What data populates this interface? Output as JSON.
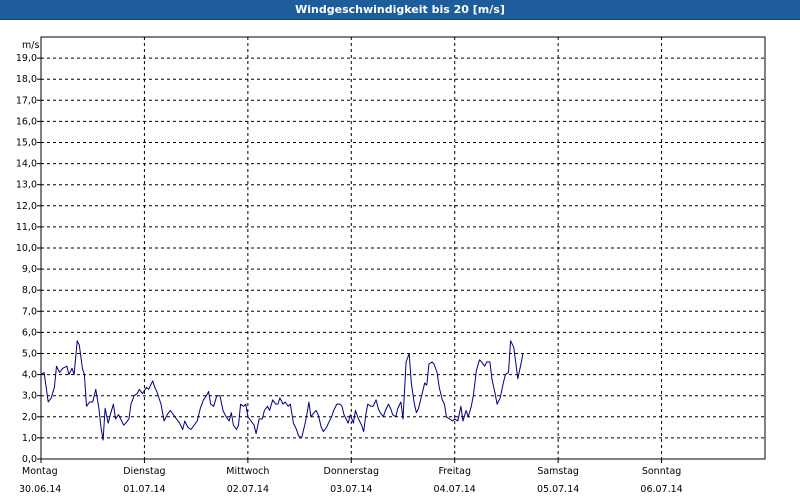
{
  "window": {
    "title": "Windgeschwindigkeit bis 20 [m/s]"
  },
  "colors": {
    "titlebar": "#1d5d9b",
    "line": "#00007f",
    "grid": "#000000"
  },
  "chart_data": {
    "type": "line",
    "title": "Windgeschwindigkeit bis 20 [m/s]",
    "ylabel": "m/s",
    "ylim": [
      0,
      20
    ],
    "yticks": [
      "0,0",
      "1,0",
      "2,0",
      "3,0",
      "4,0",
      "5,0",
      "6,0",
      "7,0",
      "8,0",
      "9,0",
      "10,0",
      "11,0",
      "12,0",
      "13,0",
      "14,0",
      "15,0",
      "16,0",
      "17,0",
      "18,0",
      "19,0"
    ],
    "xlim": [
      0,
      7
    ],
    "grid": "dashed",
    "x_ticks": [
      {
        "day": "Montag",
        "date": "30.06.14",
        "x": 0
      },
      {
        "day": "Dienstag",
        "date": "01.07.14",
        "x": 1
      },
      {
        "day": "Mittwoch",
        "date": "02.07.14",
        "x": 2
      },
      {
        "day": "Donnerstag",
        "date": "03.07.14",
        "x": 3
      },
      {
        "day": "Freitag",
        "date": "04.07.14",
        "x": 4
      },
      {
        "day": "Samstag",
        "date": "05.07.14",
        "x": 5
      },
      {
        "day": "Sonntag",
        "date": "06.07.14",
        "x": 6
      }
    ],
    "series": [
      {
        "points": [
          [
            0.0,
            4.0
          ],
          [
            0.03,
            4.1
          ],
          [
            0.07,
            2.7
          ],
          [
            0.1,
            2.9
          ],
          [
            0.13,
            3.4
          ],
          [
            0.15,
            4.4
          ],
          [
            0.18,
            4.1
          ],
          [
            0.21,
            4.3
          ],
          [
            0.25,
            4.4
          ],
          [
            0.27,
            4.0
          ],
          [
            0.3,
            4.3
          ],
          [
            0.32,
            4.0
          ],
          [
            0.35,
            5.6
          ],
          [
            0.37,
            5.4
          ],
          [
            0.4,
            4.3
          ],
          [
            0.42,
            4.0
          ],
          [
            0.44,
            2.5
          ],
          [
            0.47,
            2.7
          ],
          [
            0.5,
            2.7
          ],
          [
            0.53,
            3.3
          ],
          [
            0.56,
            2.4
          ],
          [
            0.58,
            1.5
          ],
          [
            0.6,
            0.9
          ],
          [
            0.62,
            2.4
          ],
          [
            0.65,
            1.7
          ],
          [
            0.67,
            2.1
          ],
          [
            0.7,
            2.6
          ],
          [
            0.72,
            1.9
          ],
          [
            0.75,
            2.1
          ],
          [
            0.77,
            1.9
          ],
          [
            0.8,
            1.6
          ],
          [
            0.82,
            1.7
          ],
          [
            0.85,
            1.9
          ],
          [
            0.87,
            2.6
          ],
          [
            0.9,
            3.0
          ],
          [
            0.93,
            3.1
          ],
          [
            0.95,
            3.3
          ],
          [
            0.98,
            3.1
          ],
          [
            1.02,
            3.4
          ],
          [
            1.04,
            3.3
          ],
          [
            1.08,
            3.7
          ],
          [
            1.1,
            3.4
          ],
          [
            1.12,
            3.2
          ],
          [
            1.16,
            2.6
          ],
          [
            1.19,
            1.8
          ],
          [
            1.22,
            2.1
          ],
          [
            1.25,
            2.3
          ],
          [
            1.28,
            2.1
          ],
          [
            1.31,
            1.9
          ],
          [
            1.34,
            1.7
          ],
          [
            1.37,
            1.4
          ],
          [
            1.39,
            1.8
          ],
          [
            1.42,
            1.5
          ],
          [
            1.45,
            1.4
          ],
          [
            1.48,
            1.6
          ],
          [
            1.51,
            1.8
          ],
          [
            1.54,
            2.4
          ],
          [
            1.57,
            2.8
          ],
          [
            1.6,
            3.0
          ],
          [
            1.62,
            3.2
          ],
          [
            1.64,
            2.6
          ],
          [
            1.67,
            2.5
          ],
          [
            1.7,
            3.0
          ],
          [
            1.73,
            3.0
          ],
          [
            1.76,
            2.3
          ],
          [
            1.79,
            2.0
          ],
          [
            1.82,
            1.8
          ],
          [
            1.84,
            2.2
          ],
          [
            1.86,
            1.6
          ],
          [
            1.89,
            1.4
          ],
          [
            1.91,
            1.6
          ],
          [
            1.93,
            2.6
          ],
          [
            1.96,
            2.5
          ],
          [
            1.98,
            2.6
          ],
          [
            2.0,
            2.0
          ],
          [
            2.03,
            1.8
          ],
          [
            2.06,
            1.6
          ],
          [
            2.08,
            1.2
          ],
          [
            2.11,
            1.9
          ],
          [
            2.14,
            1.9
          ],
          [
            2.16,
            2.3
          ],
          [
            2.19,
            2.5
          ],
          [
            2.21,
            2.3
          ],
          [
            2.24,
            2.8
          ],
          [
            2.27,
            2.6
          ],
          [
            2.29,
            2.6
          ],
          [
            2.31,
            2.9
          ],
          [
            2.34,
            2.6
          ],
          [
            2.36,
            2.7
          ],
          [
            2.39,
            2.5
          ],
          [
            2.41,
            2.6
          ],
          [
            2.44,
            1.7
          ],
          [
            2.47,
            1.4
          ],
          [
            2.49,
            1.1
          ],
          [
            2.52,
            1.0
          ],
          [
            2.55,
            1.6
          ],
          [
            2.57,
            2.1
          ],
          [
            2.59,
            2.7
          ],
          [
            2.61,
            2.0
          ],
          [
            2.64,
            2.2
          ],
          [
            2.66,
            2.3
          ],
          [
            2.68,
            2.1
          ],
          [
            2.71,
            1.5
          ],
          [
            2.73,
            1.3
          ],
          [
            2.76,
            1.5
          ],
          [
            2.78,
            1.7
          ],
          [
            2.81,
            2.0
          ],
          [
            2.83,
            2.3
          ],
          [
            2.86,
            2.6
          ],
          [
            2.89,
            2.6
          ],
          [
            2.91,
            2.5
          ],
          [
            2.93,
            2.1
          ],
          [
            2.95,
            1.9
          ],
          [
            2.97,
            1.7
          ],
          [
            2.99,
            2.1
          ],
          [
            3.02,
            1.7
          ],
          [
            3.04,
            2.3
          ],
          [
            3.07,
            1.9
          ],
          [
            3.1,
            1.6
          ],
          [
            3.12,
            1.3
          ],
          [
            3.14,
            2.1
          ],
          [
            3.16,
            2.6
          ],
          [
            3.19,
            2.5
          ],
          [
            3.21,
            2.5
          ],
          [
            3.24,
            2.8
          ],
          [
            3.26,
            2.4
          ],
          [
            3.28,
            2.2
          ],
          [
            3.31,
            2.0
          ],
          [
            3.33,
            2.3
          ],
          [
            3.36,
            2.6
          ],
          [
            3.38,
            2.4
          ],
          [
            3.4,
            2.1
          ],
          [
            3.43,
            2.0
          ],
          [
            3.45,
            2.4
          ],
          [
            3.48,
            2.7
          ],
          [
            3.5,
            1.9
          ],
          [
            3.53,
            4.6
          ],
          [
            3.56,
            5.0
          ],
          [
            3.58,
            3.6
          ],
          [
            3.61,
            2.6
          ],
          [
            3.63,
            2.2
          ],
          [
            3.65,
            2.4
          ],
          [
            3.68,
            3.0
          ],
          [
            3.71,
            3.6
          ],
          [
            3.73,
            3.5
          ],
          [
            3.75,
            4.5
          ],
          [
            3.78,
            4.6
          ],
          [
            3.8,
            4.5
          ],
          [
            3.83,
            4.1
          ],
          [
            3.85,
            3.4
          ],
          [
            3.88,
            2.8
          ],
          [
            3.9,
            2.6
          ],
          [
            3.92,
            2.0
          ],
          [
            3.95,
            1.9
          ],
          [
            3.98,
            1.8
          ],
          [
            4.0,
            1.9
          ],
          [
            4.03,
            1.8
          ],
          [
            4.06,
            2.5
          ],
          [
            4.08,
            1.8
          ],
          [
            4.11,
            2.3
          ],
          [
            4.13,
            2.0
          ],
          [
            4.16,
            2.5
          ],
          [
            4.18,
            3.0
          ],
          [
            4.21,
            4.2
          ],
          [
            4.24,
            4.7
          ],
          [
            4.26,
            4.6
          ],
          [
            4.29,
            4.4
          ],
          [
            4.31,
            4.6
          ],
          [
            4.34,
            4.6
          ],
          [
            4.36,
            3.8
          ],
          [
            4.39,
            3.1
          ],
          [
            4.41,
            2.6
          ],
          [
            4.44,
            2.9
          ],
          [
            4.47,
            3.6
          ],
          [
            4.49,
            4.0
          ],
          [
            4.52,
            4.1
          ],
          [
            4.54,
            5.6
          ],
          [
            4.57,
            5.3
          ],
          [
            4.59,
            4.6
          ],
          [
            4.61,
            3.8
          ],
          [
            4.64,
            4.5
          ],
          [
            4.66,
            5.0
          ]
        ]
      }
    ]
  }
}
